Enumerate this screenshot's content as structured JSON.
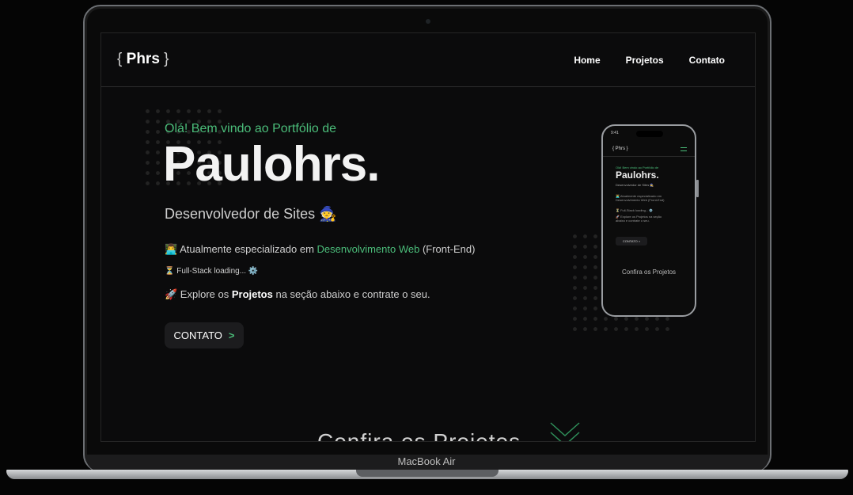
{
  "device": {
    "label": "MacBook Air"
  },
  "nav": {
    "logo_open": "{",
    "logo_text": "Phrs",
    "logo_close": "}",
    "links": [
      "Home",
      "Projetos",
      "Contato"
    ]
  },
  "hero": {
    "greeting": "Olá! Bem vindo ao Portfólio de",
    "name": "Paulohrs.",
    "role": "Desenvolvedor de Sites 🧙",
    "line1_prefix": "👨‍💻 Atualmente especializado em ",
    "line1_highlight": "Desenvolvimento Web",
    "line1_suffix": " (Front-End)",
    "line2": "⏳ Full-Stack loading... ⚙️",
    "line3_prefix": "🚀 Explore os ",
    "line3_bold": "Projetos",
    "line3_suffix": " na seção abaixo e contrate o seu.",
    "button_label": "CONTATO",
    "button_arrow": ">"
  },
  "projects_heading": "Confira os Projetos",
  "phone": {
    "status_time": "9:41",
    "logo": "{ Phrs }",
    "greeting": "Olá! Bem vindo ao Portfólio de",
    "name": "Paulohrs.",
    "role": "Desenvolvedor de Sites 🧙",
    "line1": "👨‍💻 Atualmente especializado em Desenvolvimento Web (Front-End)",
    "line2": "⏳ Full-Stack loading... ⚙️",
    "line3": "🚀 Explore os Projetos na seção abaixo e contrate o seu.",
    "button": "CONTATO >",
    "section": "Confira os Projetos"
  },
  "colors": {
    "accent": "#4bbd7a",
    "background": "#0b0b0c",
    "button": "#1c1c1e"
  }
}
